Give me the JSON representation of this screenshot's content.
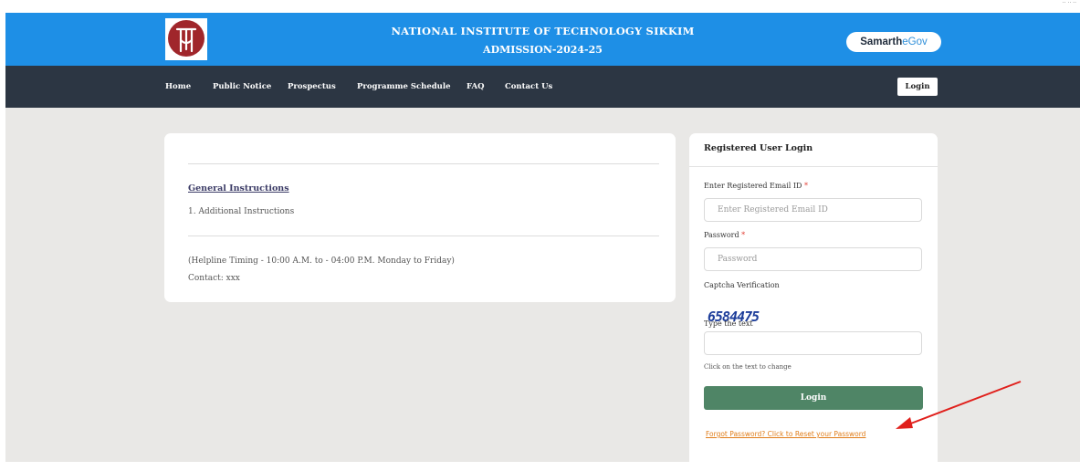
{
  "header": {
    "institute": "NATIONAL INSTITUTE OF TECHNOLOGY SIKKIM",
    "admission": "ADMISSION-2024-25",
    "brand_part1": "Samarth",
    "brand_part2": "eGov",
    "logo_icon": "nit-sikkim-logo"
  },
  "nav": {
    "items": [
      {
        "label": "Home"
      },
      {
        "label": "Public Notice"
      },
      {
        "label": "Prospectus"
      },
      {
        "label": "Programme Schedule"
      },
      {
        "label": "FAQ"
      },
      {
        "label": "Contact Us"
      }
    ],
    "login_label": "Login"
  },
  "info": {
    "heading": "General Instructions",
    "item1": "1. Additional Instructions",
    "helpline": "(Helpline Timing - 10:00 A.M. to - 04:00 P.M. Monday to Friday)",
    "contact": "Contact: xxx"
  },
  "login_card": {
    "title": "Registered User Login",
    "email_label": "Enter Registered Email ID",
    "email_placeholder": "Enter Registered Email ID",
    "password_label": "Password",
    "password_placeholder": "Password",
    "required_mark": "*",
    "captcha_label": "Captcha Verification",
    "captcha_text": "6584475",
    "type_text_label": "Type the text",
    "captcha_hint": "Click on the text to change",
    "login_button": "Login",
    "forgot_link": "Forgot Password? Click to Reset your Password"
  },
  "colors": {
    "header_blue": "#1e8fe6",
    "nav_dark": "#2c3643",
    "login_green": "#4f8566",
    "forgot_orange": "#e07d1a",
    "annotation_arrow": "#e0201c"
  }
}
